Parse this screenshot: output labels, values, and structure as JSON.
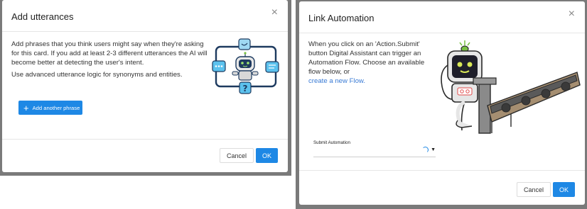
{
  "left_modal": {
    "title": "Add utterances",
    "close_glyph": "×",
    "paragraph_1": "Add phrases that you think users might say when they're asking for this card. If you add at least 2-3 different utterances the AI will become better at detecting the user's intent.",
    "paragraph_2": "Use advanced utterance logic for synonyms and entities.",
    "add_button_label": "Add another phrase",
    "add_button_icon": "plus-icon",
    "cancel_label": "Cancel",
    "ok_label": "OK"
  },
  "right_modal": {
    "title": "Link Automation",
    "close_glyph": "×",
    "description": "When you click on an 'Action.Submit' button Digital Assistant can trigger an Automation Flow. Choose an available flow below, or",
    "create_link": "create a new Flow.",
    "field_label": "Submit Automation",
    "field_value": "",
    "dropdown_icon": "caret-down-icon",
    "cancel_label": "Cancel",
    "ok_label": "OK"
  },
  "colors": {
    "primary": "#1e88e5",
    "backdrop": "#7a7a7a",
    "link": "#3a7bd5",
    "robot_green": "#79c142"
  }
}
